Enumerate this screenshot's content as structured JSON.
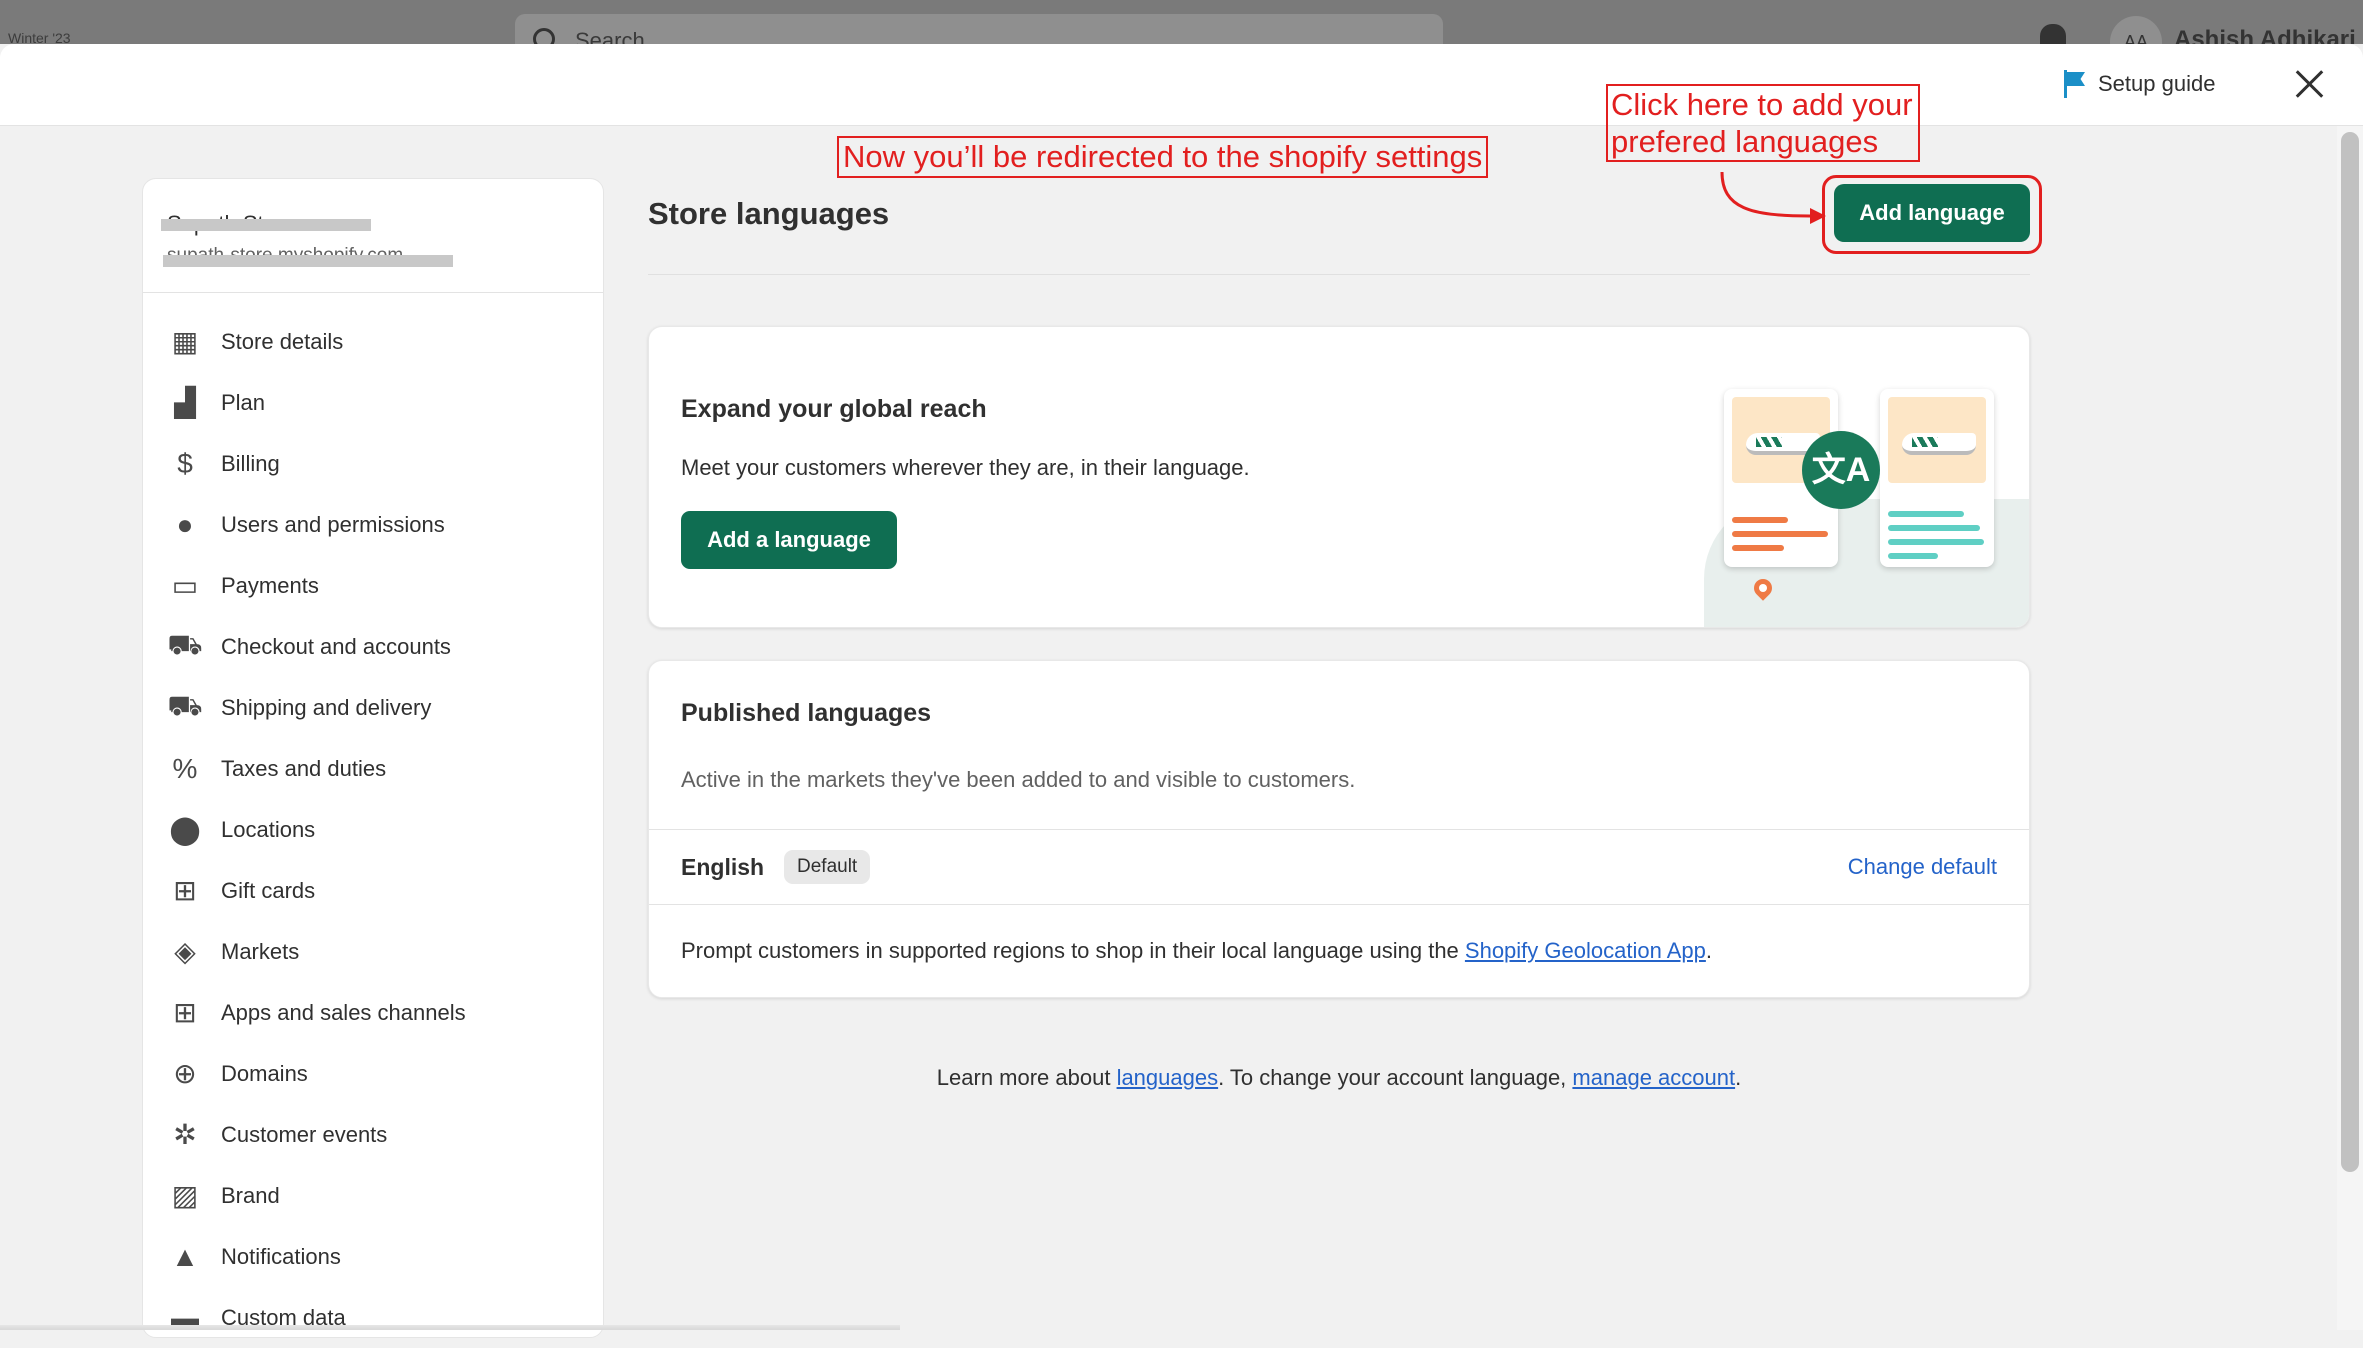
{
  "background_app": {
    "chip": "Winter '23",
    "search_placeholder": "Search",
    "avatar_initials": "AA",
    "user_name": "Ashish Adhikari"
  },
  "topbar": {
    "setup_guide_label": "Setup guide"
  },
  "sidebar": {
    "store_name": "Supath St",
    "store_url": "supath-store.myshopify.com",
    "items": [
      {
        "label": "Store details",
        "icon": "store-icon"
      },
      {
        "label": "Plan",
        "icon": "plan-icon"
      },
      {
        "label": "Billing",
        "icon": "billing-icon"
      },
      {
        "label": "Users and permissions",
        "icon": "user-icon"
      },
      {
        "label": "Payments",
        "icon": "payments-icon"
      },
      {
        "label": "Checkout and accounts",
        "icon": "cart-icon"
      },
      {
        "label": "Shipping and delivery",
        "icon": "truck-icon"
      },
      {
        "label": "Taxes and duties",
        "icon": "tax-icon"
      },
      {
        "label": "Locations",
        "icon": "location-pin-icon"
      },
      {
        "label": "Gift cards",
        "icon": "gift-icon"
      },
      {
        "label": "Markets",
        "icon": "globe-icon"
      },
      {
        "label": "Apps and sales channels",
        "icon": "apps-icon"
      },
      {
        "label": "Domains",
        "icon": "web-icon"
      },
      {
        "label": "Customer events",
        "icon": "cursor-click-icon"
      },
      {
        "label": "Brand",
        "icon": "brand-icon"
      },
      {
        "label": "Notifications",
        "icon": "bell-icon"
      },
      {
        "label": "Custom data",
        "icon": "custom-data-icon"
      }
    ]
  },
  "main": {
    "title": "Store languages",
    "add_language_button": "Add language",
    "expand_card": {
      "title": "Expand your global reach",
      "description": "Meet your customers wherever they are, in their language.",
      "button": "Add a language",
      "illustration_glyph": "文A"
    },
    "published_card": {
      "title": "Published languages",
      "description": "Active in the markets they've been added to and visible to customers.",
      "language": "English",
      "badge": "Default",
      "change_default": "Change default",
      "prompt_before": "Prompt customers in supported regions to shop in their local language using the ",
      "prompt_link": "Shopify Geolocation App",
      "prompt_after": "."
    },
    "footer": {
      "text1": "Learn more about ",
      "link1": "languages",
      "text2": ". To change your account language, ",
      "link2": "manage account",
      "text3": "."
    }
  },
  "annotations": {
    "redirect_note": "Now you’ll be redirected to the shopify settings",
    "click_note": "Click here to add your prefered languages",
    "color": "#e21f1f"
  },
  "colors": {
    "primary_green": "#0f6e52",
    "link_blue": "#2463c9",
    "setup_flag": "#1b8fc7"
  }
}
